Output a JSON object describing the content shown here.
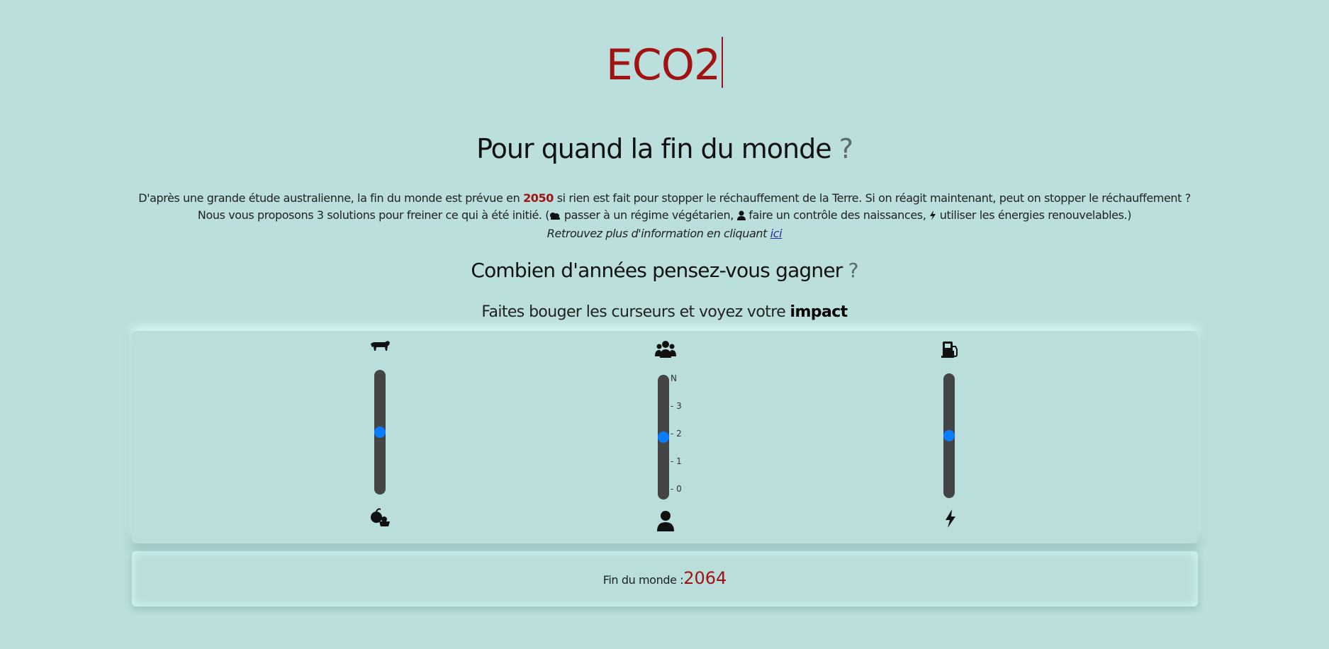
{
  "logo": {
    "text": "ECO2"
  },
  "heading": {
    "main": "Pour quand la fin du monde",
    "qmark": "?"
  },
  "intro": {
    "part1": "D'après une grande étude australienne, la fin du monde est prévue en",
    "year": "2050",
    "part2": "si rien est fait pour stopper le réchauffement de la Terre. Si on réagit maintenant, peut on stopper le réchauffement ? Nous vous proposons 3 solutions pour freiner ce qui à été initié. (",
    "sol1": "passer à un régime végétarien,",
    "sol2": "faire un contrôle des naissances,",
    "sol3": "utiliser les énergies renouvelables.)",
    "more": "Retrouvez plus d'information en cliquant",
    "link": "ici"
  },
  "question": {
    "text": "Combien d'années pensez-vous gagner",
    "qmark": "?"
  },
  "instructions": {
    "prefix": "Faites bouger les curseurs et voyez votre",
    "bold": "impact"
  },
  "sliders": [
    {
      "top_icon": "cow-icon",
      "bottom_icon": "vegetables-icon",
      "value": 0.5
    },
    {
      "top_icon": "people-group-icon",
      "bottom_icon": "person-icon",
      "value": 0.5,
      "ticks": [
        "N",
        "3",
        "2",
        "1",
        "0"
      ]
    },
    {
      "top_icon": "fuel-pump-icon",
      "bottom_icon": "lightning-icon",
      "value": 0.5
    }
  ],
  "result": {
    "label": "Fin du monde :",
    "value": "2064"
  },
  "colors": {
    "accent": "#a11212",
    "background": "#badfdd",
    "thumb": "#0a7cff",
    "track": "#444444"
  }
}
